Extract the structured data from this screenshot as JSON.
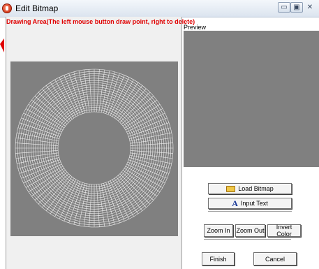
{
  "window": {
    "title": "Edit Bitmap",
    "min_glyph": "▭",
    "max_glyph": "▣",
    "close_glyph": "✕"
  },
  "drawing": {
    "title": "Drawing Area(The left mouse button draw point, right to delete)"
  },
  "preview": {
    "label": "Preview"
  },
  "buttons": {
    "load_bitmap": "Load Bitmap",
    "input_text": "Input Text",
    "zoom_in": "Zoom In",
    "zoom_out": "Zoom Out",
    "invert_color": "Invert Color",
    "finish": "Finish",
    "cancel": "Cancel"
  },
  "icons": {
    "app": "app-icon",
    "load_bitmap": "folder-icon",
    "input_text": "text-A-icon"
  },
  "colors": {
    "canvas": "#808080",
    "grid": "#f0f0f0",
    "title_red": "#e00000"
  }
}
